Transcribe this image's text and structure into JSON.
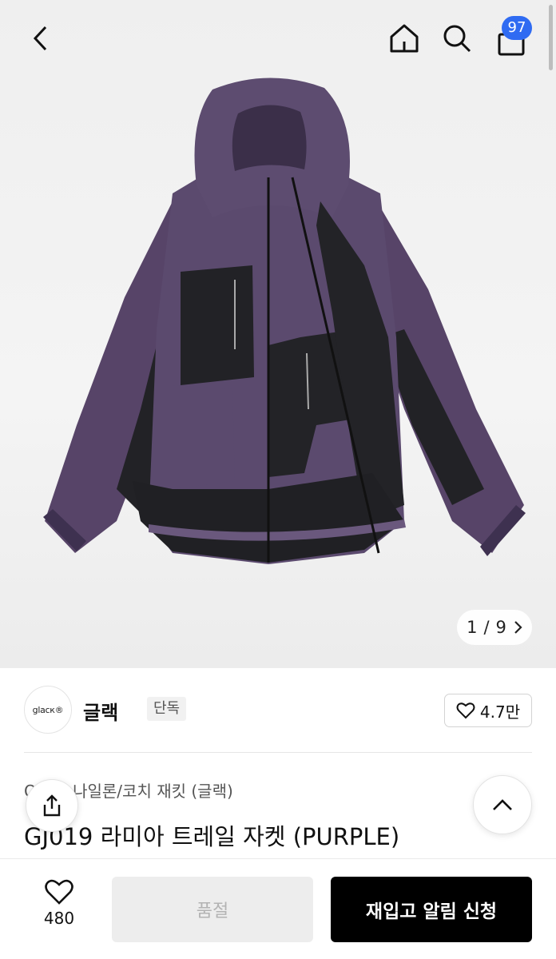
{
  "header": {
    "cart_count": "97"
  },
  "gallery": {
    "current": "1",
    "separator": "/",
    "total": "9"
  },
  "brand": {
    "logo_text": "glacк®",
    "name": "글랙",
    "tag": "단독",
    "likes": "4.7만"
  },
  "product": {
    "breadcrumb_prefix": "OU",
    "breadcrumb_category": "나일론/코치 재킷 (글랙)",
    "title": "GJ019 라미아 트레일 자켓 (PURPLE)"
  },
  "bottom_bar": {
    "wish_count": "480",
    "soldout_label": "품절",
    "restock_label": "재입고 알림 신청"
  },
  "colors": {
    "badge": "#2f6bf2",
    "jacket_purple": "#5b4a6e",
    "jacket_black": "#1f1f22",
    "primary_button": "#000000"
  }
}
